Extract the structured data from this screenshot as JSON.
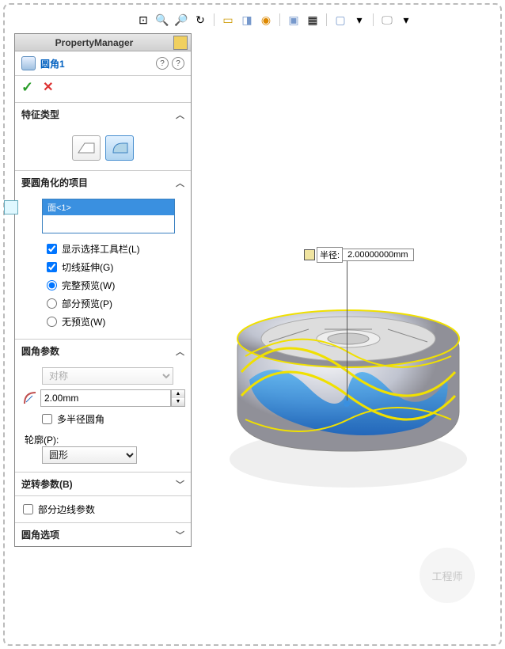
{
  "panel_title": "PropertyManager",
  "feature_name": "圆角1",
  "sections": {
    "type": {
      "title": "特征类型"
    },
    "items": {
      "title": "要圆角化的项目",
      "selected": "面<1>"
    },
    "checks": {
      "show_toolbar": "显示选择工具栏(L)",
      "tangent": "切线延伸(G)",
      "full_preview": "完整预览(W)",
      "partial_preview": "部分预览(P)",
      "no_preview": "无预览(W)"
    },
    "params": {
      "title": "圆角参数",
      "symmetry": "对称",
      "radius_value": "2.00mm",
      "multi_radius": "多半径圆角",
      "profile_label": "轮廓(P):",
      "profile_value": "圆形"
    },
    "reverse": {
      "title": "逆转参数(B)"
    },
    "partial_edge": {
      "label": "部分边线参数"
    },
    "options": {
      "title": "圆角选项"
    }
  },
  "callout": {
    "label": "半径:",
    "value": "2.00000000mm"
  },
  "watermark": "工程师"
}
